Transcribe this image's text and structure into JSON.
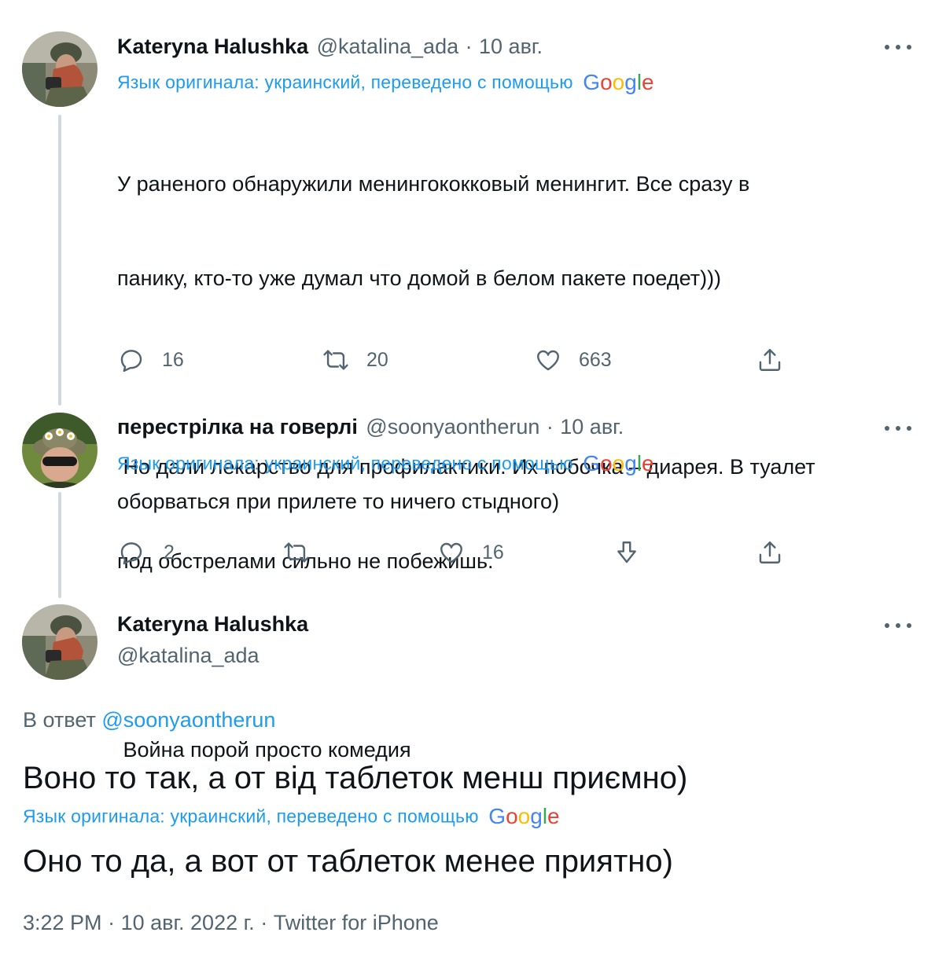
{
  "google_brand": [
    "G",
    "o",
    "o",
    "g",
    "l",
    "e"
  ],
  "colors": {
    "link": "#1d9bf0",
    "secondary": "#536471",
    "primary": "#0f1419",
    "thread_line": "#cfd9de"
  },
  "tweet1": {
    "name": "Kateryna Halushka",
    "handle": "@katalina_ada",
    "dot": "·",
    "date": "10 авг.",
    "translate_label": "Язык оригинала: украинский, переведено с помощью",
    "text_lines": [
      "У раненого обнаружили менингококковый менингит. Все сразу в",
      "панику, кто-то уже думал что домой в белом пакете поедет)))",
      " Но дали лекарство для профилактики. Их побочка – диарея. В туалет",
      "под обстрелами сильно не побежишь.",
      " Война порой просто комедия"
    ],
    "replies": "16",
    "retweets": "20",
    "likes": "663",
    "avatar_icon": "avatar-photo-icon"
  },
  "tweet2": {
    "name": "перестрілка на говерлі",
    "handle": "@soonyaontherun",
    "dot": "·",
    "date": "10 авг.",
    "translate_label": "Язык оригинала: украинский, переведено с помощью",
    "text": "оборваться при прилете то ничего стыдного)",
    "replies": "2",
    "likes": "16"
  },
  "tweet3": {
    "name": "Kateryna Halushka",
    "handle": "@katalina_ada",
    "reply_prefix": "В ответ",
    "reply_handle": "@soonyaontherun",
    "original_text": "Воно то так, а от від таблеток менш приємно)",
    "translate_label": "Язык оригинала: украинский, переведено с помощью",
    "translated_text": "Оно то да, а вот от таблеток менее приятно)",
    "time": "3:22 PM",
    "dot": "·",
    "date": "10 авг. 2022 г.",
    "dot2": "·",
    "source": "Twitter for iPhone"
  }
}
